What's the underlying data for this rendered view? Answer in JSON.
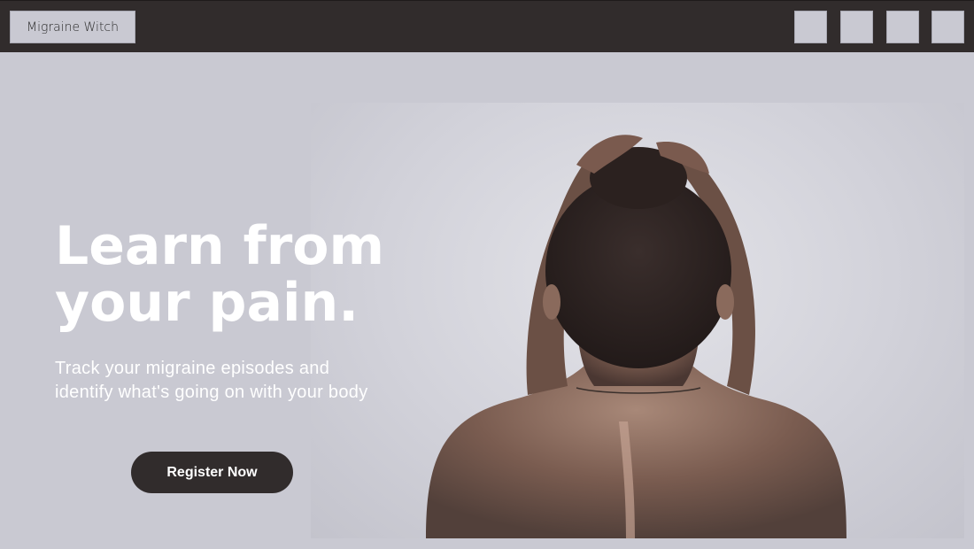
{
  "header": {
    "brand_label": "Migraine Witch",
    "nav_buttons": [
      "",
      "",
      "",
      ""
    ]
  },
  "hero": {
    "headline_line1": "Learn from",
    "headline_line2": "your pain.",
    "subtext": "Track your migraine episodes and identify what's going on with your body",
    "cta_label": "Register Now"
  },
  "colors": {
    "page_background": "#c9c9d2",
    "header_background": "#312c2c",
    "cta_background": "#312c2c",
    "text_on_dark": "#ffffff"
  }
}
